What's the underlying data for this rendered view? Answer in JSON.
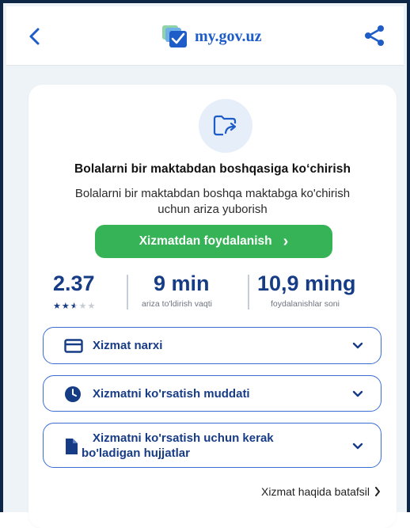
{
  "header": {
    "title": "my.gov.uz",
    "back_icon": "chevron-left-icon",
    "share_icon": "share-icon"
  },
  "service": {
    "icon": "folder-share-icon",
    "title": "Bolalarni bir maktabdan boshqasiga ko‘chirish",
    "description": "Bolalarni bir maktabdan boshqa maktabga ko'chirish uchun ariza yuborish",
    "cta_label": "Xizmatdan foydalanish",
    "cta_chevron": "›"
  },
  "stats": {
    "rating": "2.37",
    "rating_stars": 2.5,
    "rating_stars_text": "★★★★★",
    "time_value": "9 min",
    "time_label": "ariza to'ldirish vaqti",
    "users_value": "10,9 ming",
    "users_label": "foydalanishlar soni"
  },
  "accordions": [
    {
      "label": "Xizmat narxi",
      "icon": "card-icon"
    },
    {
      "label": "Xizmatni ko'rsatish muddati",
      "icon": "clock-icon"
    },
    {
      "label_line1": "Xizmatni ko'rsatish uchun kerak",
      "label_line2": "bo'ladigan hujjatlar",
      "icon": "document-icon"
    }
  ],
  "more_link": "Xizmat haqida batafsil",
  "colors": {
    "accent_blue": "#173c86",
    "link_blue": "#3a6dd4",
    "cta_green": "#35b356",
    "icon_bg": "#e6eefa"
  }
}
